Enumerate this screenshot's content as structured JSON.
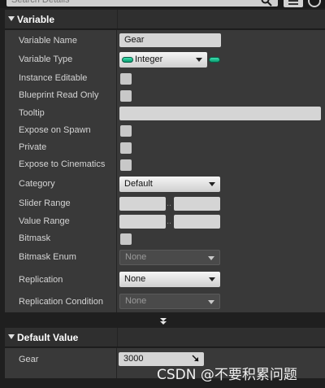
{
  "search": {
    "placeholder": "Search Details"
  },
  "variable_section": {
    "title": "Variable",
    "rows": {
      "variable_name": {
        "label": "Variable Name",
        "value": "Gear"
      },
      "variable_type": {
        "label": "Variable Type",
        "value": "Integer",
        "pin_color": "#1ec08c"
      },
      "instance_editable": {
        "label": "Instance Editable"
      },
      "blueprint_read_only": {
        "label": "Blueprint Read Only"
      },
      "tooltip": {
        "label": "Tooltip",
        "value": ""
      },
      "expose_on_spawn": {
        "label": "Expose on Spawn"
      },
      "private": {
        "label": "Private"
      },
      "expose_to_cinematics": {
        "label": "Expose to Cinematics"
      },
      "category": {
        "label": "Category",
        "value": "Default"
      },
      "slider_range": {
        "label": "Slider Range",
        "separator": ".."
      },
      "value_range": {
        "label": "Value Range",
        "separator": ".."
      },
      "bitmask": {
        "label": "Bitmask"
      },
      "bitmask_enum": {
        "label": "Bitmask Enum",
        "value": "None"
      },
      "replication": {
        "label": "Replication",
        "value": "None"
      },
      "replication_condition": {
        "label": "Replication Condition",
        "value": "None"
      }
    }
  },
  "default_value_section": {
    "title": "Default Value",
    "rows": {
      "gear": {
        "label": "Gear",
        "value": "3000"
      }
    }
  },
  "watermark": {
    "text": "CSDN @不要积累问题"
  },
  "colors": {
    "panel_bg": "#393939",
    "header_bg": "#2f2f2f",
    "field_bg": "#d5d5d5",
    "integer_pin": "#1ec08c"
  }
}
